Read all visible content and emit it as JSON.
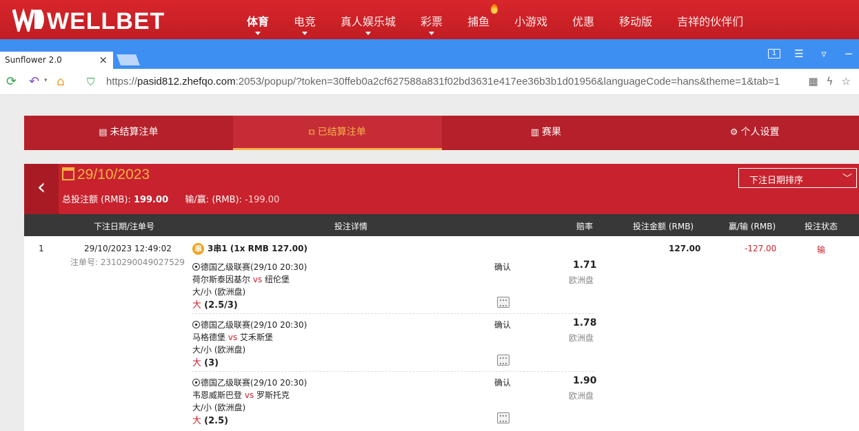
{
  "site": {
    "logo_text": "WELLBET",
    "nav": [
      {
        "label": "体育",
        "active": true,
        "caret": true
      },
      {
        "label": "电竞",
        "caret": true
      },
      {
        "label": "真人娱乐城",
        "caret": true
      },
      {
        "label": "彩票",
        "caret": true
      },
      {
        "label": "捕鱼",
        "hot": true
      },
      {
        "label": "小游戏"
      },
      {
        "label": "优惠"
      },
      {
        "label": "移动版"
      },
      {
        "label": "吉祥的伙伴们"
      }
    ]
  },
  "browser": {
    "tab_title": "Sunflower 2.0",
    "tab_close": "×",
    "url_prefix": "https://",
    "url_host": "pasid812.zhefqo.com",
    "url_rest": ":2053/popup/?token=30ffeb0a2cf627588a831f02bd3631e417ee36b3b1d01956&languageCode=hans&theme=1&tab=1"
  },
  "tabs": [
    {
      "label": "未结算注单",
      "icon": "list-icon"
    },
    {
      "label": "已结算注单",
      "icon": "settled-icon",
      "active": true
    },
    {
      "label": "赛果",
      "icon": "results-icon"
    },
    {
      "label": "个人设置",
      "icon": "gear-icon"
    }
  ],
  "summary": {
    "date": "29/10/2023",
    "total_label": "总投注额 (RMB):",
    "total_value": "199.00",
    "winloss_label": "输/赢: (RMB):",
    "winloss_value": "-199.00",
    "sort_label": "下注日期排序"
  },
  "table": {
    "headers": {
      "date_id": "下注日期/注单号",
      "detail": "投注详情",
      "odds": "赔率",
      "stake": "投注金额 (RMB)",
      "winloss": "赢/输 (RMB)",
      "status": "投注状态"
    },
    "row": {
      "index": "1",
      "datetime": "29/10/2023 12:49:02",
      "ticket_id": "注单号: 2310290049027529",
      "parlay_badge": "串",
      "parlay_title": "3串1 (1x RMB 127.00)",
      "stake": "127.00",
      "winloss": "-127.00",
      "status": "输"
    },
    "legs": [
      {
        "league": "德国乙级联赛(29/10 20:30)",
        "home": "荷尔斯泰因基尔",
        "vs": "vs",
        "away": "纽伦堡",
        "market": "大/小 (欧洲盘)",
        "pick": "大",
        "line": "(2.5/3)",
        "confirm": "确认",
        "odds": "1.71",
        "odds_type": "欧洲盘"
      },
      {
        "league": "德国乙级联赛(29/10 20:30)",
        "home": "马格德堡",
        "vs": "vs",
        "away": "艾禾斯堡",
        "market": "大/小 (欧洲盘)",
        "pick": "大",
        "line": "(3)",
        "confirm": "确认",
        "odds": "1.78",
        "odds_type": "欧洲盘"
      },
      {
        "league": "德国乙级联赛(29/10 20:30)",
        "home": "韦恩威斯巴登",
        "vs": "vs",
        "away": "罗斯托克",
        "market": "大/小 (欧洲盘)",
        "pick": "大",
        "line": "(2.5)",
        "confirm": "确认",
        "odds": "1.90",
        "odds_type": "欧洲盘"
      }
    ]
  },
  "colors": {
    "brand_red": "#c7222d",
    "accent_gold": "#f6b34a",
    "browser_blue": "#3e8ff2"
  }
}
